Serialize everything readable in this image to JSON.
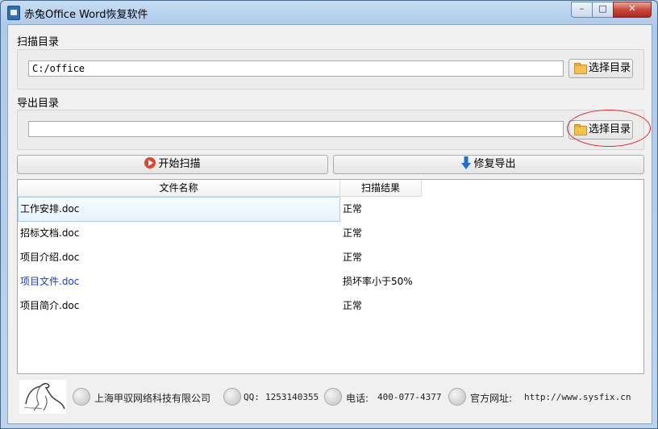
{
  "window": {
    "title": "赤兔Office Word恢复软件",
    "controls": {
      "minimize": "–",
      "maximize": "□",
      "close": "✕"
    }
  },
  "scan_dir": {
    "label": "扫描目录",
    "value": "C:/office",
    "button_label": "选择目录"
  },
  "export_dir": {
    "label": "导出目录",
    "value": "",
    "button_label": "选择目录"
  },
  "actions": {
    "start_scan": "开始扫描",
    "repair_export": "修复导出"
  },
  "table": {
    "columns": [
      "文件名称",
      "扫描结果"
    ],
    "rows": [
      {
        "name": "工作安排.doc",
        "result": "正常"
      },
      {
        "name": "招标文档.doc",
        "result": "正常"
      },
      {
        "name": "项目介绍.doc",
        "result": "正常"
      },
      {
        "name": "项目文件.doc",
        "result": "损坏率小于50%"
      },
      {
        "name": "项目简介.doc",
        "result": "正常"
      }
    ]
  },
  "footer": {
    "company": "上海甲驭网络科技有限公司",
    "qq_label": "QQ:",
    "qq": "1253140355",
    "phone_label": "电话:",
    "phone": "400-077-4377",
    "website_label": "官方网址:",
    "website": "http://www.sysfix.cn"
  },
  "colors": {
    "accent_red": "#e0282a",
    "link_blue": "#1a3ccc",
    "title_bar": "#b9d1ea"
  },
  "icons": [
    "app-icon",
    "folder-icon",
    "play-icon",
    "down-arrow-icon",
    "building-icon",
    "qq-penguin-icon",
    "phone-icon",
    "globe-icon",
    "horse-logo"
  ]
}
